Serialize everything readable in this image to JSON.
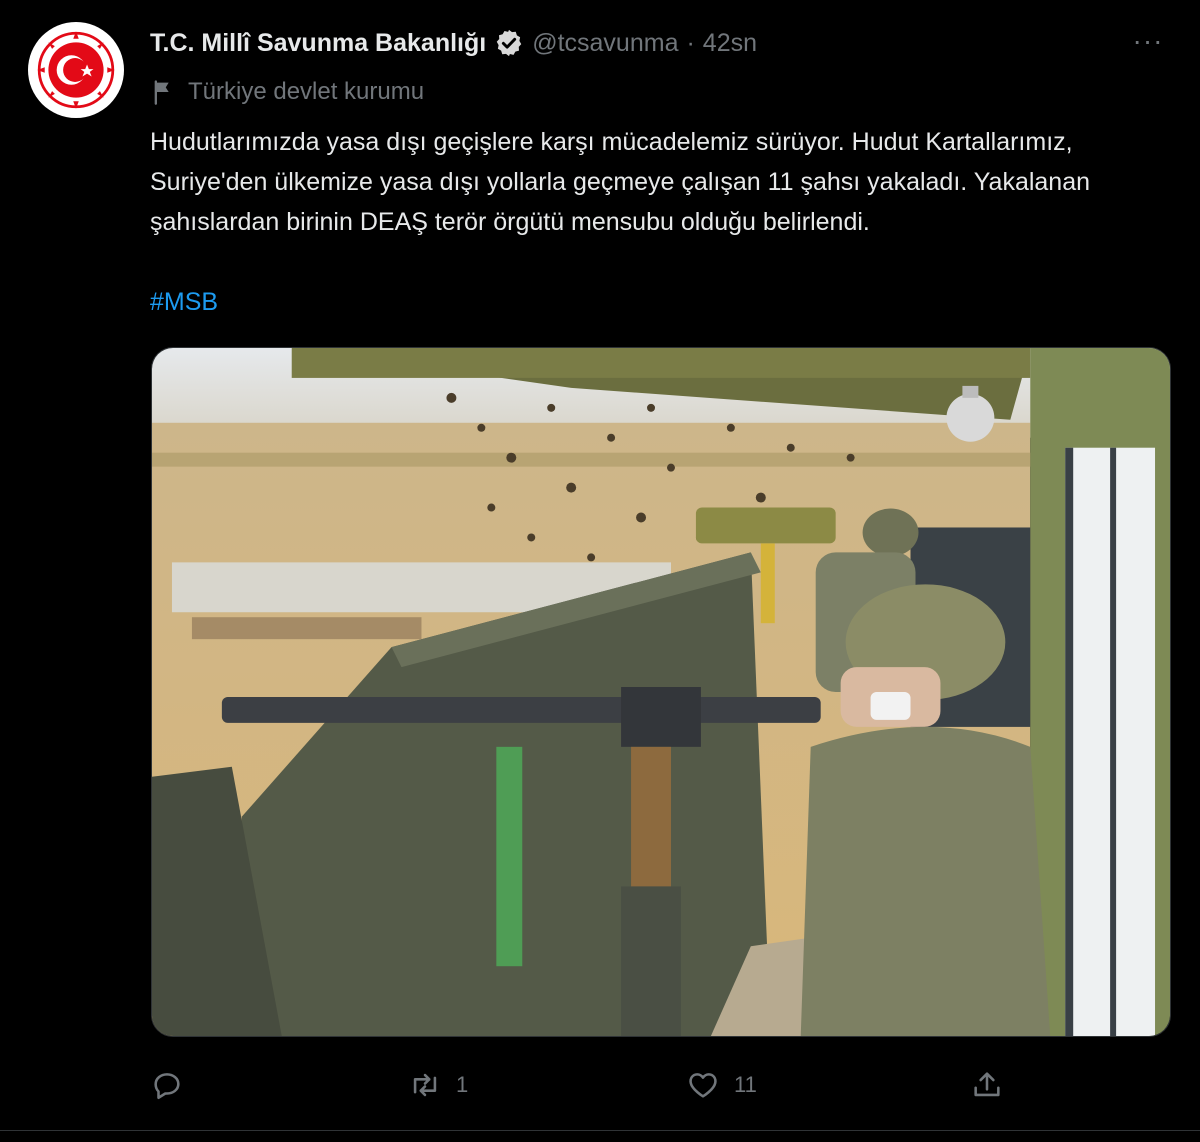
{
  "author": {
    "display_name": "T.C. Millî Savunma Bakanlığı",
    "handle": "@tcsavunma",
    "separator": "·",
    "time": "42sn",
    "verified": true,
    "avatar_icon": "crescent-star-emblem-icon"
  },
  "more_label": "···",
  "affiliation": {
    "icon": "flag-icon",
    "label": "Türkiye devlet kurumu"
  },
  "tweet": {
    "text": "Hudutlarımızda yasa dışı geçişlere karşı mücadelemiz sürüyor. Hudut Kartallarımız, Suriye'den ülkemize yasa dışı yollarla geçmeye çalışan 11 şahsı yakaladı. Yakalanan şahıslardan birinin DEAŞ terör örgütü mensubu olduğu belirlendi.",
    "hashtag": "#MSB"
  },
  "media": {
    "alt_icon": "photo-soldiers-watchtower"
  },
  "actions": {
    "reply": {
      "icon": "reply-icon",
      "count": ""
    },
    "retweet": {
      "icon": "retweet-icon",
      "count": "1"
    },
    "like": {
      "icon": "heart-icon",
      "count": "11"
    },
    "share": {
      "icon": "share-icon",
      "count": ""
    }
  },
  "colors": {
    "background": "#000000",
    "text": "#e7e9ea",
    "muted": "#71767b",
    "link": "#1d9bf0",
    "verified_badge": "#d9d9d9",
    "emblem_red": "#e30a17"
  }
}
